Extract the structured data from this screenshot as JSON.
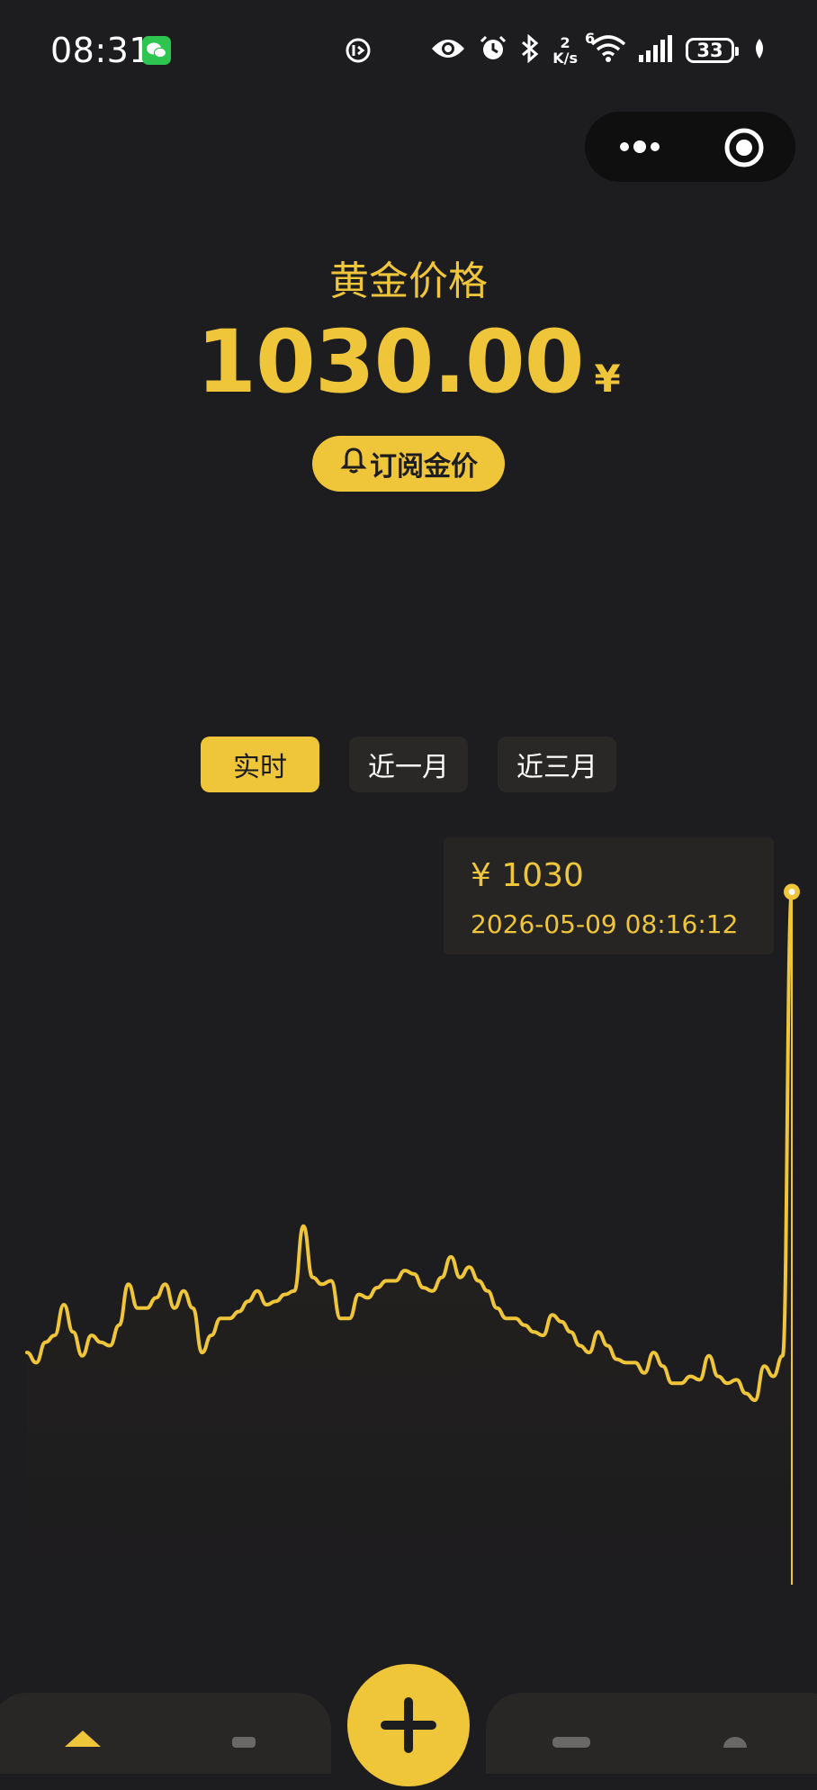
{
  "status_bar": {
    "time": "08:31",
    "net_speed_value": "2",
    "net_speed_unit": "K/s",
    "wifi_gen": "6",
    "battery": "33"
  },
  "capsule": {
    "more_icon": "more-dots-icon",
    "close_icon": "target-close-icon"
  },
  "header": {
    "title": "黄金价格",
    "price": "1030.00",
    "currency": "¥",
    "subscribe_label": "订阅金价"
  },
  "tabs": [
    {
      "label": "实时",
      "active": true
    },
    {
      "label": "近一月",
      "active": false
    },
    {
      "label": "近三月",
      "active": false
    }
  ],
  "tooltip": {
    "price": "¥ 1030",
    "time": "2026-05-09 08:16:12"
  },
  "colors": {
    "accent": "#efc53a",
    "background": "#1d1c1e",
    "tab_inactive": "#2a2826",
    "tooltip_bg": "#272523"
  },
  "chart_data": {
    "type": "line",
    "title": "",
    "xlabel": "",
    "ylabel": "",
    "grid": false,
    "ylim": [
      1012,
      1031
    ],
    "series": [
      {
        "values": [
          1016.3,
          1016.0,
          1016.6,
          1016.8,
          1017.7,
          1016.9,
          1016.2,
          1016.8,
          1016.6,
          1016.5,
          1017.1,
          1018.3,
          1017.6,
          1017.6,
          1017.9,
          1018.3,
          1017.6,
          1018.1,
          1017.6,
          1016.3,
          1016.8,
          1017.3,
          1017.3,
          1017.5,
          1017.8,
          1018.1,
          1017.7,
          1017.8,
          1018.0,
          1018.1,
          1020.0,
          1018.5,
          1018.3,
          1018.4,
          1017.3,
          1017.3,
          1018.0,
          1017.9,
          1018.2,
          1018.4,
          1018.4,
          1018.7,
          1018.6,
          1018.2,
          1018.1,
          1018.5,
          1019.1,
          1018.5,
          1018.8,
          1018.4,
          1018.1,
          1017.6,
          1017.3,
          1017.3,
          1017.1,
          1016.9,
          1016.8,
          1017.4,
          1017.2,
          1016.9,
          1016.5,
          1016.3,
          1016.9,
          1016.5,
          1016.1,
          1016.0,
          1016.0,
          1015.7,
          1016.3,
          1015.9,
          1015.4,
          1015.4,
          1015.6,
          1015.5,
          1016.2,
          1015.6,
          1015.4,
          1015.5,
          1015.1,
          1014.9,
          1015.9,
          1015.6,
          1016.2,
          1029.8
        ]
      }
    ],
    "highlight": {
      "price": 1030,
      "time": "2026-05-09 08:16:12"
    }
  }
}
